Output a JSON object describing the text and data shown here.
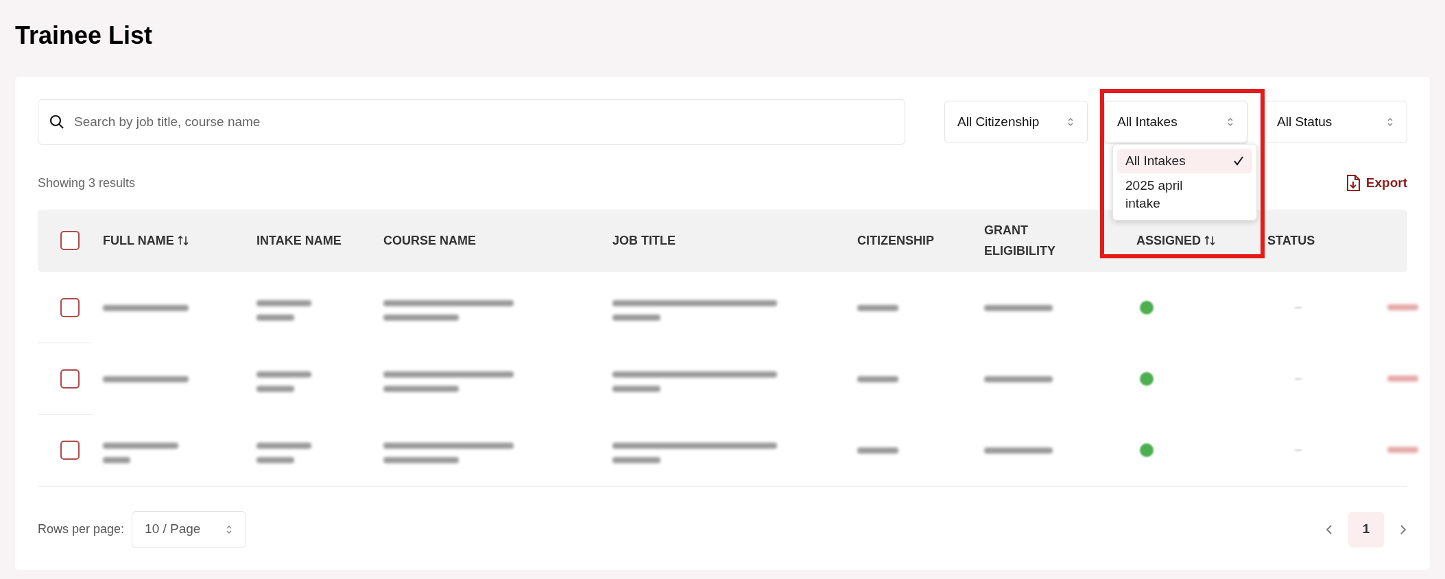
{
  "page_title": "Trainee List",
  "search": {
    "placeholder": "Search by job title, course name"
  },
  "filters": [
    {
      "label": "All Citizenship",
      "open": false
    },
    {
      "label": "All Intakes",
      "open": true
    },
    {
      "label": "All Status",
      "open": false
    }
  ],
  "intake_menu": [
    {
      "label": "All Intakes",
      "selected": true
    },
    {
      "label": "2025 april intake",
      "selected": false
    }
  ],
  "result_count": "Showing 3 results",
  "export": "Export",
  "table": {
    "columns": [
      {
        "label": "FULL NAME",
        "sortable": true
      },
      {
        "label": "INTAKE NAME",
        "sortable": false
      },
      {
        "label": "COURSE NAME",
        "sortable": false
      },
      {
        "label": "JOB TITLE",
        "sortable": false
      },
      {
        "label": "CITIZENSHIP",
        "sortable": false
      },
      {
        "label": "GRANT ELIGIBILITY",
        "sortable": false
      },
      {
        "label": "ASSIGNED",
        "sortable": true
      },
      {
        "label": "STATUS",
        "sortable": false
      }
    ],
    "all_checked": false,
    "rows": [
      {
        "checked": false,
        "assigned": true
      },
      {
        "checked": false,
        "assigned": true
      },
      {
        "checked": false,
        "assigned": true
      }
    ]
  },
  "pagination": {
    "rows_label": "Rows per page:",
    "page_size": "10 / Page",
    "pages": [
      {
        "label": "1",
        "selected": true
      }
    ]
  }
}
